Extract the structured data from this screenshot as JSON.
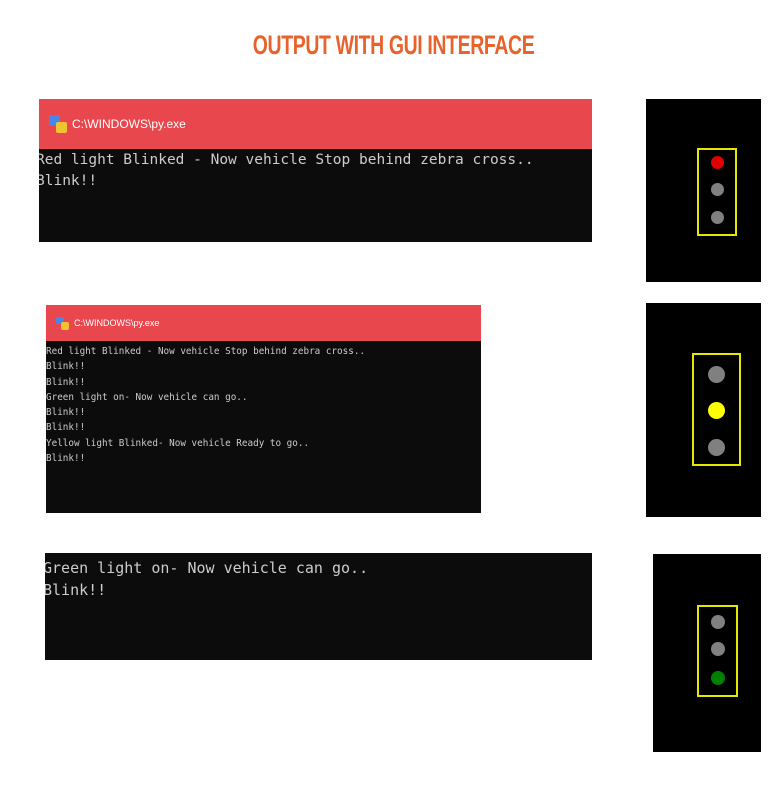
{
  "heading": {
    "text": "OUTPUT WITH GUI INTERFACE",
    "color": "#e8622c"
  },
  "windows": [
    {
      "title": "C:\\WINDOWS\\py.exe",
      "lines": [
        "Red light Blinked - Now vehicle Stop behind zebra cross..",
        "Blink!!"
      ]
    },
    {
      "title": "C:\\WINDOWS\\py.exe",
      "lines": [
        "Red light Blinked - Now vehicle Stop behind zebra cross..",
        "Blink!!",
        "Blink!!",
        "Green light on- Now vehicle can go..",
        "Blink!!",
        "Blink!!",
        "Yellow light Blinked- Now vehicle Ready to go..",
        "Blink!!"
      ]
    },
    {
      "lines": [
        "Green light on- Now vehicle can go..",
        "Blink!!"
      ]
    }
  ],
  "signals": [
    {
      "active": "red",
      "lamps": [
        "#e00000",
        "#808080",
        "#808080"
      ]
    },
    {
      "active": "yellow",
      "lamps": [
        "#808080",
        "#ffff00",
        "#808080"
      ]
    },
    {
      "active": "green",
      "lamps": [
        "#808080",
        "#808080",
        "#008000"
      ]
    }
  ],
  "colors": {
    "titlebar": "#e8474e",
    "console_bg": "#0c0c0c",
    "console_text": "#cccccc",
    "signal_bg": "#000000",
    "signal_frame": "#e6e600"
  }
}
